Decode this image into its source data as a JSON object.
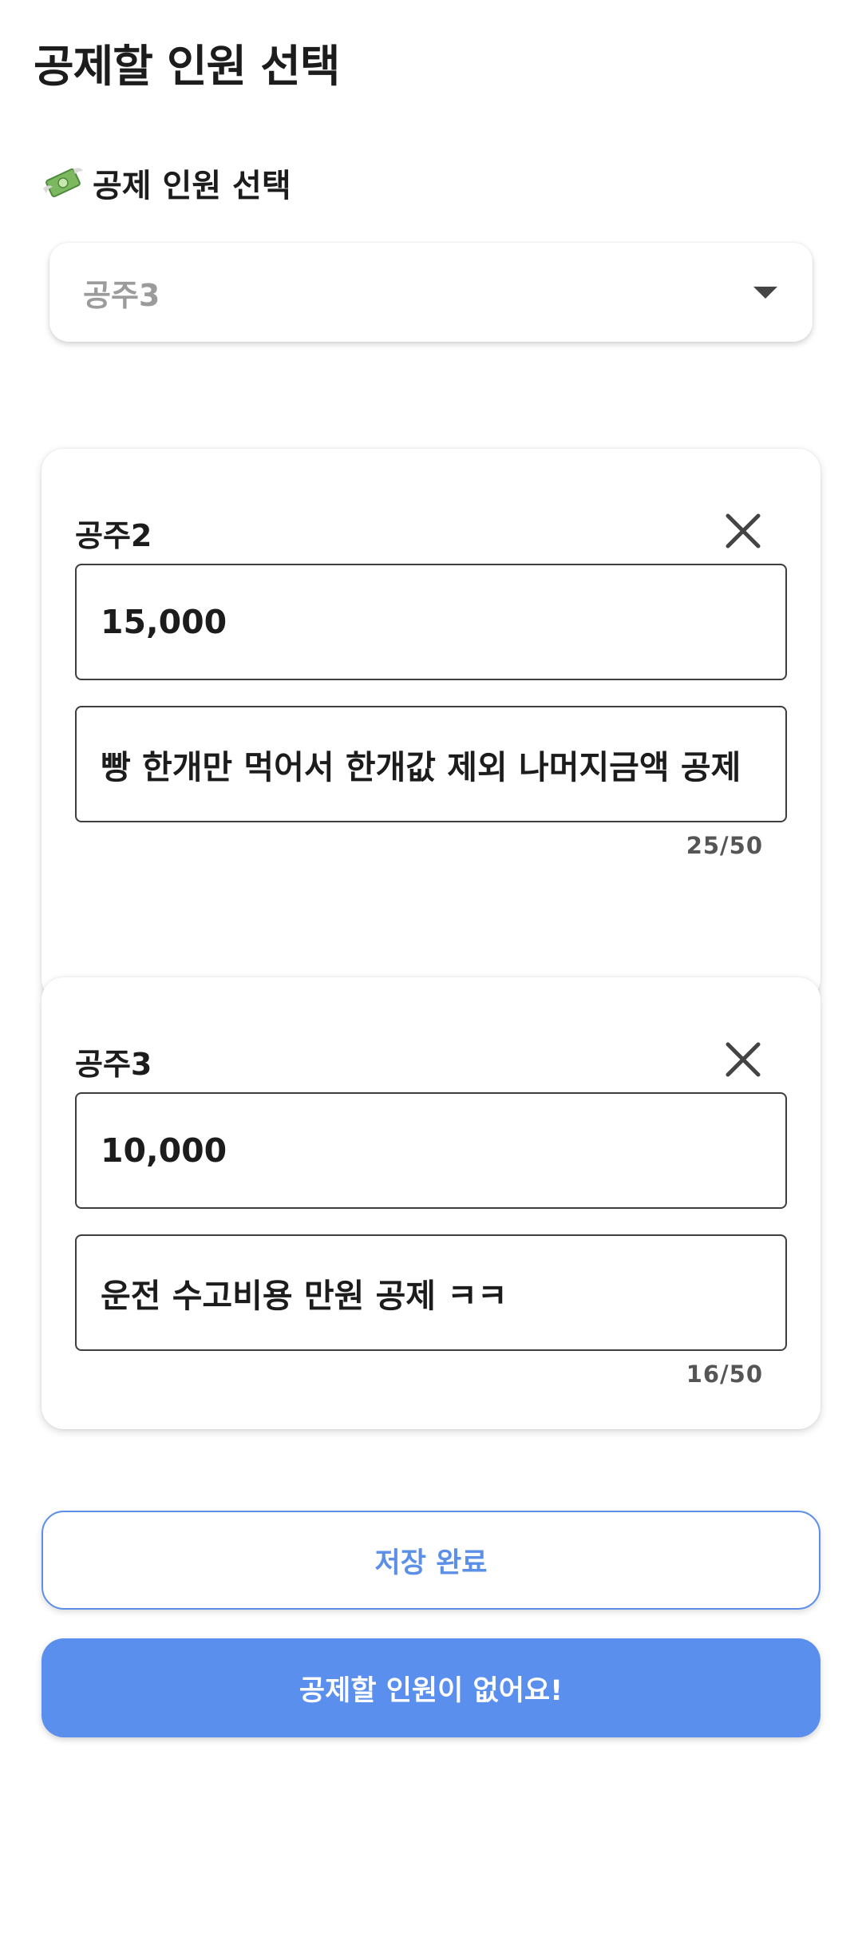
{
  "page": {
    "title": "공제할 인원 선택"
  },
  "selector": {
    "section_label": "공제 인원 선택",
    "section_icon": "money-with-wings-icon",
    "selected_value": "공주3"
  },
  "deductions": [
    {
      "name": "공주2",
      "amount": "15,000",
      "memo": "빵 한개만 먹어서 한개값 제외 나머지금액 공제",
      "counter": "25/50"
    },
    {
      "name": "공주3",
      "amount": "10,000",
      "memo": "운전 수고비용 만원 공제 ㅋㅋ",
      "counter": "16/50"
    }
  ],
  "actions": {
    "save_label": "저장 완료",
    "primary_label": "공제할 인원이 없어요!"
  },
  "colors": {
    "accent": "#5b8fee",
    "border": "#3d3d3d",
    "placeholder": "#9b9b9b"
  }
}
